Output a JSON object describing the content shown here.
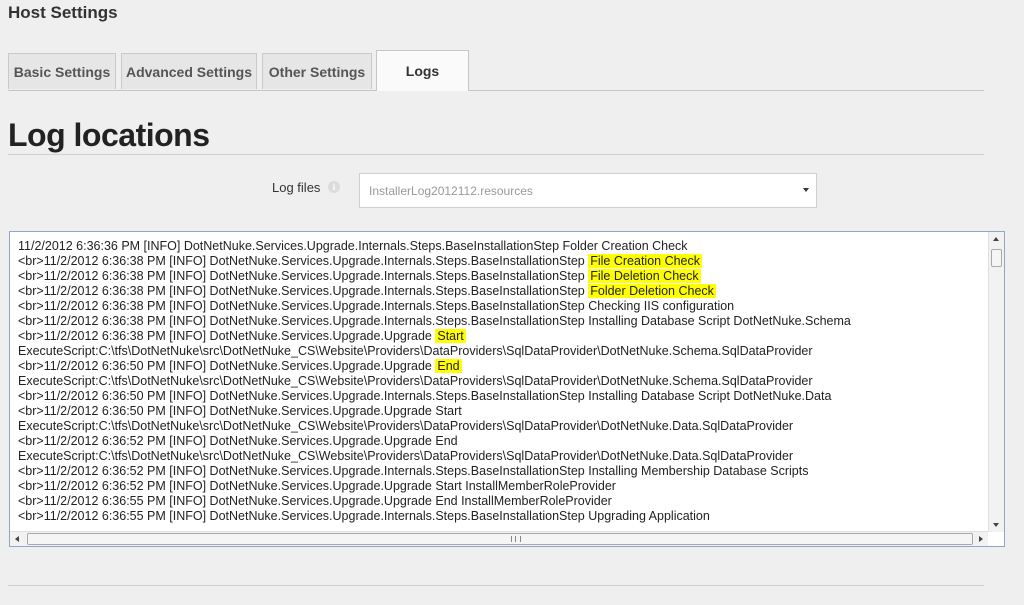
{
  "page": {
    "title": "Host Settings"
  },
  "tabs": [
    {
      "label": "Basic Settings",
      "active": false
    },
    {
      "label": "Advanced Settings",
      "active": false
    },
    {
      "label": "Other Settings",
      "active": false
    },
    {
      "label": "Logs",
      "active": true
    }
  ],
  "section": {
    "title": "Log locations"
  },
  "log_files": {
    "label": "Log files",
    "info_icon": "info-icon",
    "selected": "InstallerLog2012112.resources"
  },
  "log_lines": [
    {
      "text": "11/2/2012 6:36:36 PM [INFO] DotNetNuke.Services.Upgrade.Internals.Steps.BaseInstallationStep Folder Creation Check",
      "highlight": ""
    },
    {
      "text": "<br>11/2/2012 6:36:38 PM [INFO] DotNetNuke.Services.Upgrade.Internals.Steps.BaseInstallationStep ",
      "highlight": "File Creation Check"
    },
    {
      "text": "<br>11/2/2012 6:36:38 PM [INFO] DotNetNuke.Services.Upgrade.Internals.Steps.BaseInstallationStep ",
      "highlight": "File Deletion Check"
    },
    {
      "text": "<br>11/2/2012 6:36:38 PM [INFO] DotNetNuke.Services.Upgrade.Internals.Steps.BaseInstallationStep ",
      "highlight": "Folder Deletion Check"
    },
    {
      "text": "<br>11/2/2012 6:36:38 PM [INFO] DotNetNuke.Services.Upgrade.Internals.Steps.BaseInstallationStep Checking IIS configuration",
      "highlight": ""
    },
    {
      "text": "<br>11/2/2012 6:36:38 PM [INFO] DotNetNuke.Services.Upgrade.Internals.Steps.BaseInstallationStep Installing Database Script DotNetNuke.Schema",
      "highlight": ""
    },
    {
      "text": "<br>11/2/2012 6:36:38 PM [INFO] DotNetNuke.Services.Upgrade.Upgrade ",
      "highlight": "Start"
    },
    {
      "text": "ExecuteScript:C:\\tfs\\DotNetNuke\\src\\DotNetNuke_CS\\Website\\Providers\\DataProviders\\SqlDataProvider\\DotNetNuke.Schema.SqlDataProvider",
      "highlight": ""
    },
    {
      "text": "<br>11/2/2012 6:36:50 PM [INFO] DotNetNuke.Services.Upgrade.Upgrade ",
      "highlight": "End"
    },
    {
      "text": "ExecuteScript:C:\\tfs\\DotNetNuke\\src\\DotNetNuke_CS\\Website\\Providers\\DataProviders\\SqlDataProvider\\DotNetNuke.Schema.SqlDataProvider",
      "highlight": ""
    },
    {
      "text": "<br>11/2/2012 6:36:50 PM [INFO] DotNetNuke.Services.Upgrade.Internals.Steps.BaseInstallationStep Installing Database Script DotNetNuke.Data",
      "highlight": ""
    },
    {
      "text": "<br>11/2/2012 6:36:50 PM [INFO] DotNetNuke.Services.Upgrade.Upgrade Start",
      "highlight": ""
    },
    {
      "text": "ExecuteScript:C:\\tfs\\DotNetNuke\\src\\DotNetNuke_CS\\Website\\Providers\\DataProviders\\SqlDataProvider\\DotNetNuke.Data.SqlDataProvider",
      "highlight": ""
    },
    {
      "text": "<br>11/2/2012 6:36:52 PM [INFO] DotNetNuke.Services.Upgrade.Upgrade End",
      "highlight": ""
    },
    {
      "text": "ExecuteScript:C:\\tfs\\DotNetNuke\\src\\DotNetNuke_CS\\Website\\Providers\\DataProviders\\SqlDataProvider\\DotNetNuke.Data.SqlDataProvider",
      "highlight": ""
    },
    {
      "text": "<br>11/2/2012 6:36:52 PM [INFO] DotNetNuke.Services.Upgrade.Internals.Steps.BaseInstallationStep Installing Membership Database Scripts",
      "highlight": ""
    },
    {
      "text": "<br>11/2/2012 6:36:52 PM [INFO] DotNetNuke.Services.Upgrade.Upgrade Start InstallMemberRoleProvider",
      "highlight": ""
    },
    {
      "text": "<br>11/2/2012 6:36:55 PM [INFO] DotNetNuke.Services.Upgrade.Upgrade End InstallMemberRoleProvider",
      "highlight": ""
    },
    {
      "text": "<br>11/2/2012 6:36:55 PM [INFO] DotNetNuke.Services.Upgrade.Internals.Steps.BaseInstallationStep Upgrading Application",
      "highlight": ""
    }
  ],
  "colors": {
    "highlight": "#ffff00",
    "log_border": "#8fa6c8"
  }
}
